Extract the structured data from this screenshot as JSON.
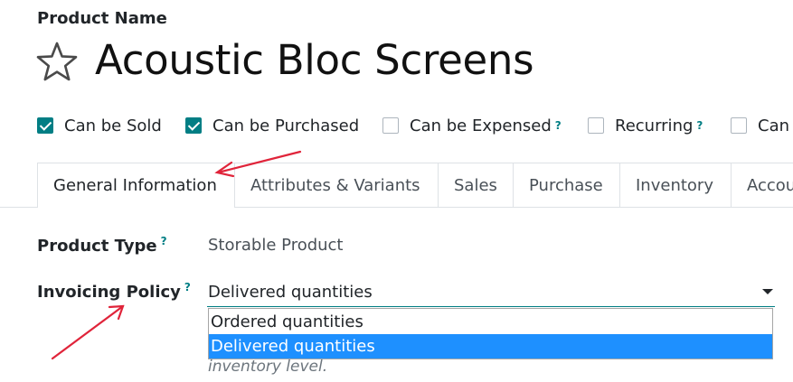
{
  "form": {
    "caption": "Product Name",
    "title": "Acoustic Bloc Screens",
    "star_icon": "star-outline-icon"
  },
  "checkboxes": [
    {
      "label": "Can be Sold",
      "checked": true,
      "help": ""
    },
    {
      "label": "Can be Purchased",
      "checked": true,
      "help": ""
    },
    {
      "label": "Can be Expensed",
      "checked": false,
      "help": "?"
    },
    {
      "label": "Recurring",
      "checked": false,
      "help": "?"
    },
    {
      "label": "Can",
      "checked": false,
      "help": ""
    }
  ],
  "tabs": [
    {
      "label": "General Information",
      "active": true
    },
    {
      "label": "Attributes & Variants",
      "active": false
    },
    {
      "label": "Sales",
      "active": false
    },
    {
      "label": "Purchase",
      "active": false
    },
    {
      "label": "Inventory",
      "active": false
    },
    {
      "label": "Accou",
      "active": false
    }
  ],
  "fields": {
    "product_type": {
      "label": "Product Type",
      "help": "?",
      "value": "Storable Product"
    },
    "invoicing_policy": {
      "label": "Invoicing Policy",
      "help": "?",
      "value": "Delivered quantities"
    }
  },
  "dropdown": {
    "options": [
      "Ordered quantities",
      "Delivered quantities"
    ],
    "selected_index": 1
  },
  "hint_text": "inventory level.",
  "colors": {
    "accent": "#017e84",
    "annotation": "#e0243a",
    "selection": "#1e90ff"
  }
}
